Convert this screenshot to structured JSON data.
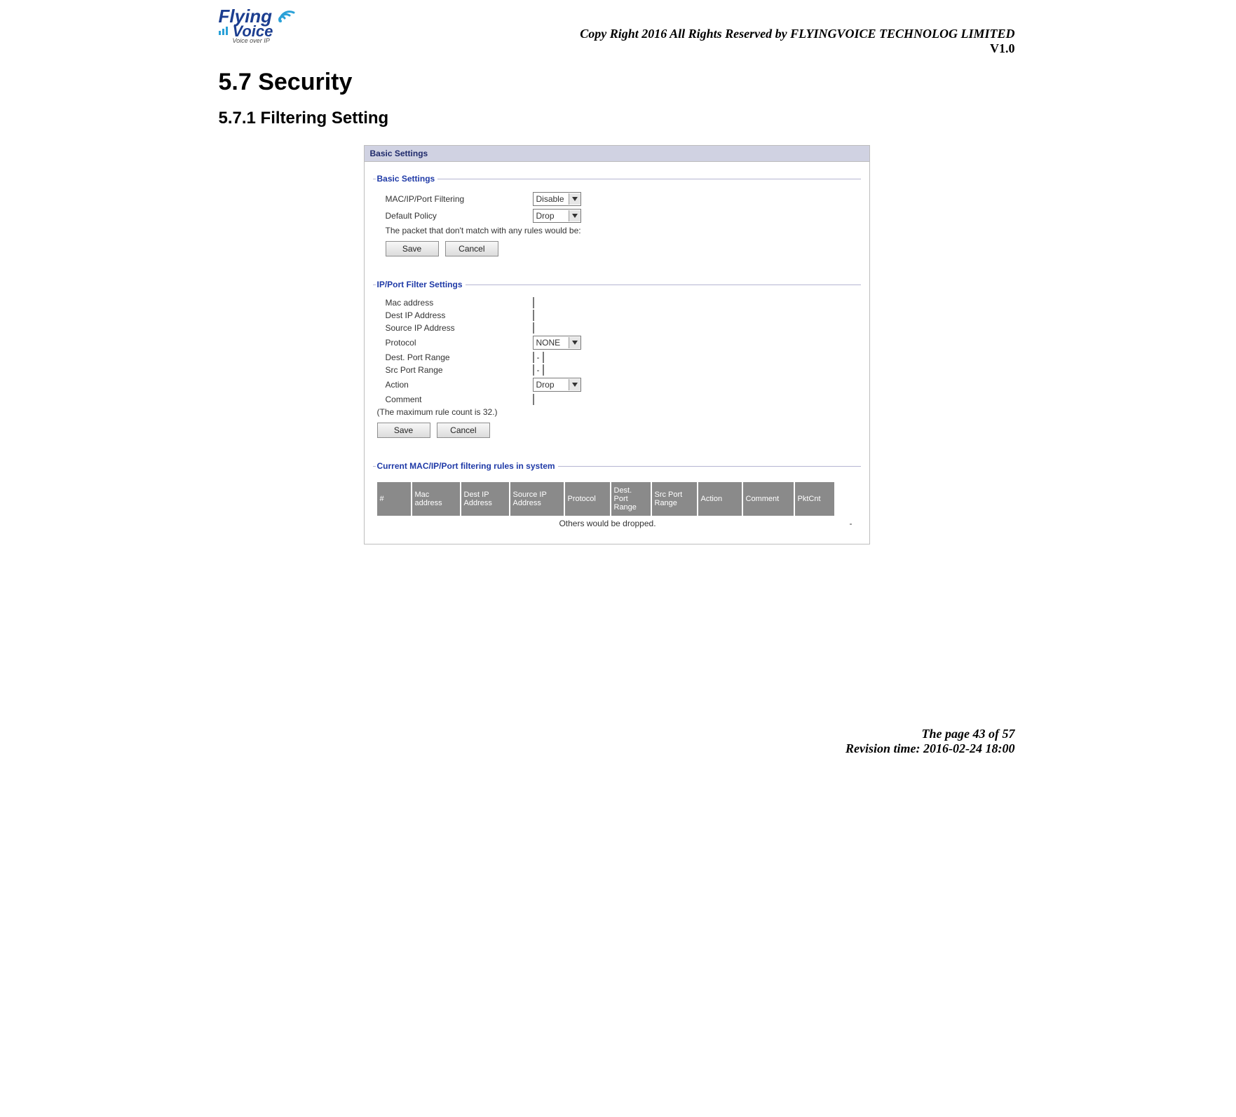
{
  "header": {
    "logo": {
      "line1": "Flying",
      "line2": "Voice",
      "tag": "Voice over IP"
    },
    "copyright": "Copy Right 2016 All Rights Reserved by FLYINGVOICE TECHNOLOG LIMITED",
    "version": "V1.0"
  },
  "section": {
    "number_title": "5.7  Security"
  },
  "subsection": {
    "number_title": "5.7.1 Filtering Setting"
  },
  "panel": {
    "title": "Basic Settings",
    "basic": {
      "legend": "Basic Settings",
      "filtering_label": "MAC/IP/Port Filtering",
      "filtering_value": "Disable",
      "policy_label": "Default Policy",
      "policy_value": "Drop",
      "note": "The packet that don't match with any rules would be:",
      "save": "Save",
      "cancel": "Cancel"
    },
    "ipport": {
      "legend": "IP/Port Filter Settings",
      "mac_label": "Mac address",
      "destip_label": "Dest IP Address",
      "srcip_label": "Source IP Address",
      "protocol_label": "Protocol",
      "protocol_value": "NONE",
      "destport_label": "Dest. Port Range",
      "srcport_label": "Src Port Range",
      "action_label": "Action",
      "action_value": "Drop",
      "comment_label": "Comment",
      "max_note": "(The maximum rule count is 32.)",
      "save": "Save",
      "cancel": "Cancel"
    },
    "rules": {
      "legend": "Current MAC/IP/Port filtering rules in system",
      "headers": [
        "#",
        "Mac address",
        "Dest IP Address",
        "Source IP Address",
        "Protocol",
        "Dest. Port Range",
        "Src Port Range",
        "Action",
        "Comment",
        "PktCnt"
      ],
      "footer_text": "Others would be dropped.",
      "footer_dash": "-"
    }
  },
  "footer": {
    "page": "The page 43 of 57",
    "revision": "Revision time: 2016-02-24 18:00"
  }
}
